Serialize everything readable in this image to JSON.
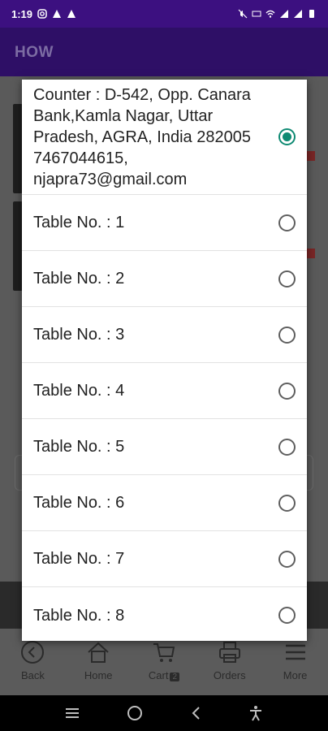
{
  "status_bar": {
    "time": "1:19",
    "left_icons": [
      "instagram-icon",
      "alert-icon",
      "alert-icon"
    ],
    "right_icons": [
      "mute-icon",
      "volte-icon",
      "wifi-icon",
      "signal-icon",
      "signal-icon",
      "battery-icon"
    ]
  },
  "app_bar": {
    "title": "HOW"
  },
  "dialog": {
    "options": [
      {
        "label": "Counter : D-542, Opp. Canara Bank,Kamla Nagar, Uttar Pradesh, AGRA, India 282005 7467044615, njapra73@gmail.com",
        "selected": true
      },
      {
        "label": "Table No. : 1",
        "selected": false
      },
      {
        "label": "Table No. : 2",
        "selected": false
      },
      {
        "label": "Table No. : 3",
        "selected": false
      },
      {
        "label": "Table No. : 4",
        "selected": false
      },
      {
        "label": "Table No. : 5",
        "selected": false
      },
      {
        "label": "Table No. : 6",
        "selected": false
      },
      {
        "label": "Table No. : 7",
        "selected": false
      },
      {
        "label": "Table No. : 8",
        "selected": false
      }
    ]
  },
  "bottom_nav": {
    "items": [
      {
        "label": "Back",
        "icon": "back-circle-icon"
      },
      {
        "label": "Home",
        "icon": "home-icon"
      },
      {
        "label": "Cart",
        "icon": "cart-icon",
        "badge": "2"
      },
      {
        "label": "Orders",
        "icon": "printer-icon"
      },
      {
        "label": "More",
        "icon": "menu-icon"
      }
    ]
  },
  "colors": {
    "status_bar": "#3c1080",
    "app_bar": "#2e0f66",
    "radio_selected": "#0f8a73",
    "scrim": "#5a5a5a"
  }
}
